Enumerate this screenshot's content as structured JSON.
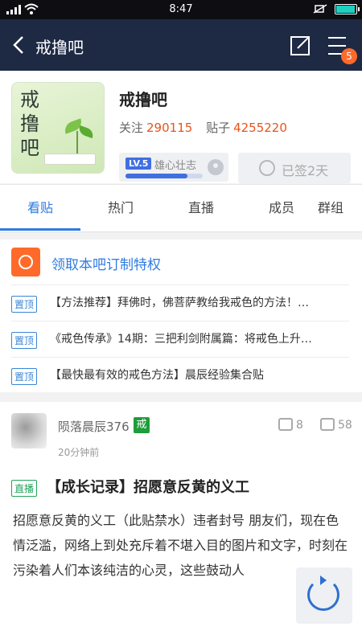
{
  "status_bar": {
    "time": "8:47"
  },
  "app_bar": {
    "title": "戒撸吧",
    "menu_badge": "5"
  },
  "forum": {
    "logo_text": "戒\n撸\n吧",
    "name": "戒撸吧",
    "follow_label": "关注",
    "follow_count": "290115",
    "posts_label": "贴子",
    "posts_count": "4255220",
    "level": "LV.5",
    "level_name": "雄心壮志",
    "level_progress": 0.8,
    "signed_label": "已签2天"
  },
  "tabs": [
    {
      "label": "看贴"
    },
    {
      "label": "热门"
    },
    {
      "label": "直播"
    },
    {
      "label": "成员"
    },
    {
      "label": "群组"
    }
  ],
  "notice": {
    "privilege": "领取本吧订制特权",
    "pinned_badge": "置顶",
    "pinned": [
      {
        "title": "【方法推荐】拜佛时，佛菩萨教给我戒色的方法！…"
      },
      {
        "title": "《戒色传承》14期：三把利剑附属篇：将戒色上升…"
      },
      {
        "title": "【最快最有效的戒色方法】晨辰经验集合贴"
      }
    ]
  },
  "post": {
    "author": "陨落晨辰376",
    "author_tag": "戒",
    "time": "20分钟前",
    "likes": "8",
    "comments": "58",
    "badge": "直播",
    "title": "【成长记录】招愿意反黄的义工",
    "body": "招愿意反黄的义工（此贴禁水）违者封号 朋友们，现在色情泛滥，网络上到处充斥着不堪入目的图片和文字，时刻在污染着人们本该纯洁的心灵，这些鼓动人"
  }
}
